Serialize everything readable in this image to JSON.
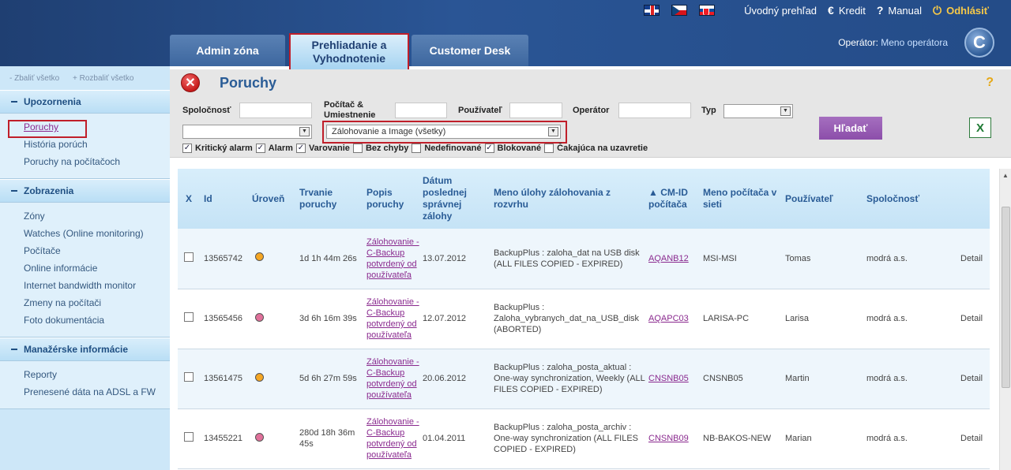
{
  "header": {
    "top_links": {
      "home": "Úvodný prehľad",
      "credit": "Kredit",
      "manual": "Manual",
      "logout": "Odhlásiť"
    },
    "tabs": [
      {
        "label": "Admin zóna"
      },
      {
        "label": "Prehliadanie a Vyhodnotenie"
      },
      {
        "label": "Customer Desk"
      }
    ],
    "operator_label": "Operátor:",
    "operator_name": "Meno operátora",
    "logo_letter": "C"
  },
  "sidebar": {
    "collapse_all": "- Zbaliť všetko",
    "expand_all": "+ Rozbaliť všetko",
    "sections": [
      {
        "title": "Upozornenia",
        "items": [
          "Poruchy",
          "História porúch",
          "Poruchy na počítačoch"
        ]
      },
      {
        "title": "Zobrazenia",
        "items": [
          "Zóny",
          "Watches (Online monitoring)",
          "Počítače",
          "Online informácie",
          "Internet bandwidth monitor",
          "Zmeny na počítači",
          "Foto dokumentácia"
        ]
      },
      {
        "title": "Manažérske informácie",
        "items": [
          "Reporty",
          "Prenesené dáta na ADSL a FW"
        ]
      }
    ]
  },
  "page": {
    "title": "Poruchy",
    "help": "?"
  },
  "filters": {
    "company_label": "Spoločnosť",
    "computer_label": "Počítač & Umiestnenie",
    "user_label": "Používateľ",
    "operator_label": "Operátor",
    "type_label": "Typ",
    "type_value": "",
    "secondary_select_value": "",
    "backup_select_value": "Zálohovanie a Image (všetky)",
    "search_button": "Hľadať",
    "checkboxes": [
      {
        "label": "Kritický alarm",
        "checked": true
      },
      {
        "label": "Alarm",
        "checked": true
      },
      {
        "label": "Varovanie",
        "checked": true
      },
      {
        "label": "Bez chyby",
        "checked": false
      },
      {
        "label": "Nedefinované",
        "checked": false
      },
      {
        "label": "Blokované",
        "checked": true
      },
      {
        "label": "Čakajúca na uzavretie",
        "checked": false
      }
    ]
  },
  "table": {
    "columns": [
      "X",
      "Id",
      "Úroveň",
      "Trvanie poruchy",
      "Popis poruchy",
      "Dátum poslednej správnej zálohy",
      "Meno úlohy zálohovania z rozvrhu",
      "▲ CM-ID počítača",
      "Meno počítača v sieti",
      "Používateľ",
      "Spoločnosť",
      ""
    ],
    "rows": [
      {
        "id": "13565742",
        "level_color": "#f5a623",
        "duration": "1d 1h 44m 26s",
        "description": "Zálohovanie - C-Backup potvrdený od používateľa",
        "last_backup": "13.07.2012",
        "job": "BackupPlus : zaloha_dat na USB disk (ALL FILES COPIED - EXPIRED)",
        "cmid": "AQANB12",
        "computer": "MSI-MSI",
        "user": "Tomas",
        "company": "modrá a.s.",
        "detail": "Detail"
      },
      {
        "id": "13565456",
        "level_color": "#e0709a",
        "duration": "3d 6h 16m 39s",
        "description": "Zálohovanie - C-Backup potvrdený od používateľa",
        "last_backup": "12.07.2012",
        "job": "BackupPlus : Zaloha_vybranych_dat_na_USB_disk (ABORTED)",
        "cmid": "AQAPC03",
        "computer": "LARISA-PC",
        "user": "Larisa",
        "company": "modrá a.s.",
        "detail": "Detail"
      },
      {
        "id": "13561475",
        "level_color": "#f5a623",
        "duration": "5d 6h 27m 59s",
        "description": "Zálohovanie - C-Backup potvrdený od používateľa",
        "last_backup": "20.06.2012",
        "job": "BackupPlus : zaloha_posta_aktual : One-way synchronization, Weekly (ALL FILES COPIED - EXPIRED)",
        "cmid": "CNSNB05",
        "computer": "CNSNB05",
        "user": "Martin",
        "company": "modrá a.s.",
        "detail": "Detail"
      },
      {
        "id": "13455221",
        "level_color": "#e0709a",
        "duration": "280d 18h 36m 45s",
        "description": "Zálohovanie - C-Backup potvrdený od používateľa",
        "last_backup": "01.04.2011",
        "job": "BackupPlus : zaloha_posta_archiv : One-way synchronization (ALL FILES COPIED - EXPIRED)",
        "cmid": "CNSNB09",
        "computer": "NB-BAKOS-NEW",
        "user": "Marian",
        "company": "modrá a.s.",
        "detail": "Detail"
      }
    ]
  },
  "colors": {
    "header_bg": "#2a5595",
    "sidebar_bg": "#cde7f8",
    "accent_link": "#8a2a8f",
    "search_button": "#9a5cb6",
    "highlight_box": "#c01f2a"
  }
}
